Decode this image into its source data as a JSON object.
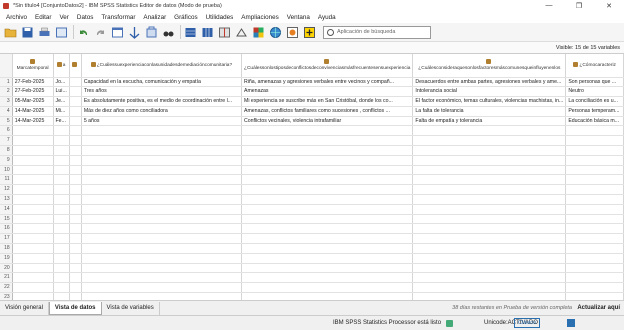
{
  "window": {
    "title": "*Sin título4 [ConjuntoDatos2] - IBM SPSS Statistics Editor de datos (Modo de prueba)"
  },
  "menu": [
    "Archivo",
    "Editar",
    "Ver",
    "Datos",
    "Transformar",
    "Analizar",
    "Gráficos",
    "Utilidades",
    "Ampliaciones",
    "Ventana",
    "Ayuda"
  ],
  "toolbar": {
    "search_placeholder": "Aplicación de búsqueda"
  },
  "visible": "Visible: 15 de 15 variables",
  "columns": [
    "Marcatemporal",
    "a",
    "",
    "¿Cuálessuexperienciaconlasunidadesdemediacióncomunitaria?",
    "¿Cuálessonlostiposdeconflictosdeconvivenciasmásfrecuentesensuexperiencia",
    "¿Cuálesconsideraquesonlosfactoresmáscomunesqueinfluyenenlos",
    "¿Cómocaracteriz"
  ],
  "rows": [
    [
      "1",
      "27-Feb-2025",
      "Jo...",
      "",
      "Capacidad en la escucha, comunicación y empatía",
      "Riña, amenazas y agresiones verbales entre vecinos y compañ...",
      "Desacuerdos entre ambas partes, agresiones verbales y ame...",
      "Son personas que ..."
    ],
    [
      "2",
      "27-Feb-2025",
      "Lui...",
      "",
      "Tres años",
      "Amenazas",
      "Intolerancia social",
      "Neutro"
    ],
    [
      "3",
      "05-Mar-2025",
      "Je...",
      "",
      "Es absolutamente positiva, es el medio de coordinación entre l...",
      "Mi experiencia se suscribe más en San Cristóbal, donde los co...",
      "El factor económico, temas culturales, violencias machistas, in...",
      "La conciliación es u..."
    ],
    [
      "4",
      "14-Mar-2025",
      "Mi...",
      "",
      "Más de diez años como conciliadora",
      "Amenazas, conflictos familiares como sucesiones , conflictos ...",
      "La falta de tolerancia",
      "Personas temperam..."
    ],
    [
      "5",
      "14-Mar-2025",
      "Fe...",
      "",
      "5 años",
      "Conflictos vecinales, violencia intrafamiliar",
      "Falta de empatía y tolerancia",
      "Educación básica m..."
    ]
  ],
  "row_count": 24,
  "tabs": [
    "Visión general",
    "Vista de datos",
    "Vista de variables"
  ],
  "trial_text": "38 días restantes en Prueba de versión completa",
  "update_text": "Actualizar aquí",
  "status": {
    "processor": "IBM SPSS Statistics Processor está listo",
    "unicode": "Unicode:ACTIVADO",
    "mode": "Clásico"
  }
}
